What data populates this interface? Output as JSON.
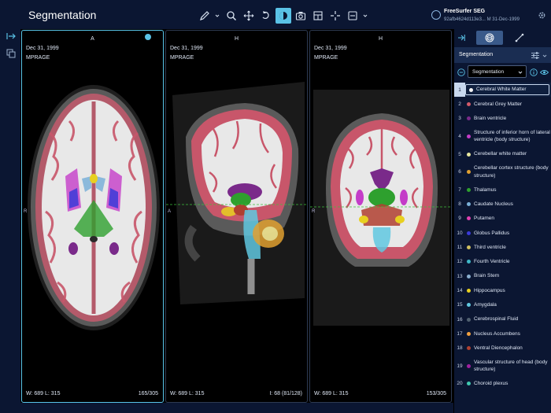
{
  "app": {
    "title": "Segmentation"
  },
  "study": {
    "title": "FreeSurfer SEG",
    "subtitle": "92afb4624d113e3...  M  31-Dec-1999"
  },
  "toolbar": {
    "tools": [
      {
        "name": "pencil-icon",
        "has_caret": true
      },
      {
        "name": "zoom-icon",
        "has_caret": false
      },
      {
        "name": "pan-icon",
        "has_caret": false
      },
      {
        "name": "rotate-icon",
        "has_caret": false
      },
      {
        "name": "contrast-icon",
        "has_caret": false,
        "active": true
      },
      {
        "name": "camera-icon",
        "has_caret": false
      },
      {
        "name": "layout-icon",
        "has_caret": false
      },
      {
        "name": "crosshair-icon",
        "has_caret": false
      },
      {
        "name": "more-tools-icon",
        "has_caret": true
      }
    ]
  },
  "viewports": [
    {
      "orientation": "A",
      "date": "Dec 31, 1999",
      "series": "MPRAGE",
      "wl": "W:  689  L:  315",
      "index": "165/305",
      "side_marker": "R",
      "active": true
    },
    {
      "orientation": "H",
      "date": "Dec 31, 1999",
      "series": "MPRAGE",
      "wl": "W:  689  L:  315",
      "index": "I: 68 (81/128)",
      "side_marker": "A",
      "active": false
    },
    {
      "orientation": "H",
      "date": "Dec 31, 1999",
      "series": "MPRAGE",
      "wl": "W:  689  L:  315",
      "index": "153/305",
      "side_marker": "R",
      "active": false
    }
  ],
  "panel": {
    "section_title": "Segmentation",
    "selected_segmentation": "Segmentation",
    "segments": [
      {
        "num": "1",
        "name": "Cerebral White Matter",
        "color": "#f5f5f5",
        "selected": true
      },
      {
        "num": "2",
        "name": "Cerebral Grey Matter",
        "color": "#d25a6a"
      },
      {
        "num": "3",
        "name": "Brain ventricle",
        "color": "#7a2a8a"
      },
      {
        "num": "4",
        "name": "Structure of inferior horn of lateral ventricle (body structure)",
        "color": "#c43cc8"
      },
      {
        "num": "5",
        "name": "Cerebellar white matter",
        "color": "#e8e8a0"
      },
      {
        "num": "6",
        "name": "Cerebellar cortex structure (body structure)",
        "color": "#e0a030"
      },
      {
        "num": "7",
        "name": "Thalamus",
        "color": "#2ea02e"
      },
      {
        "num": "8",
        "name": "Caudate Nucleus",
        "color": "#7ab0d8"
      },
      {
        "num": "9",
        "name": "Putamen",
        "color": "#e040b0"
      },
      {
        "num": "10",
        "name": "Globus Pallidus",
        "color": "#3a3ad8"
      },
      {
        "num": "11",
        "name": "Third ventricle",
        "color": "#d0c060"
      },
      {
        "num": "12",
        "name": "Fourth Ventricle",
        "color": "#40b8c8"
      },
      {
        "num": "13",
        "name": "Brain Stem",
        "color": "#8ab0d0"
      },
      {
        "num": "14",
        "name": "Hippocampus",
        "color": "#e8d020"
      },
      {
        "num": "15",
        "name": "Amygdala",
        "color": "#60c8e0"
      },
      {
        "num": "16",
        "name": "Cerebrospinal Fluid",
        "color": "#506070"
      },
      {
        "num": "17",
        "name": "Nucleus Accumbens",
        "color": "#f0a040"
      },
      {
        "num": "18",
        "name": "Ventral Diencephalon",
        "color": "#b04030"
      },
      {
        "num": "19",
        "name": "Vascular structure of head (body structure)",
        "color": "#a020a0"
      },
      {
        "num": "20",
        "name": "Choroid plexus",
        "color": "#40c8b0"
      }
    ]
  }
}
